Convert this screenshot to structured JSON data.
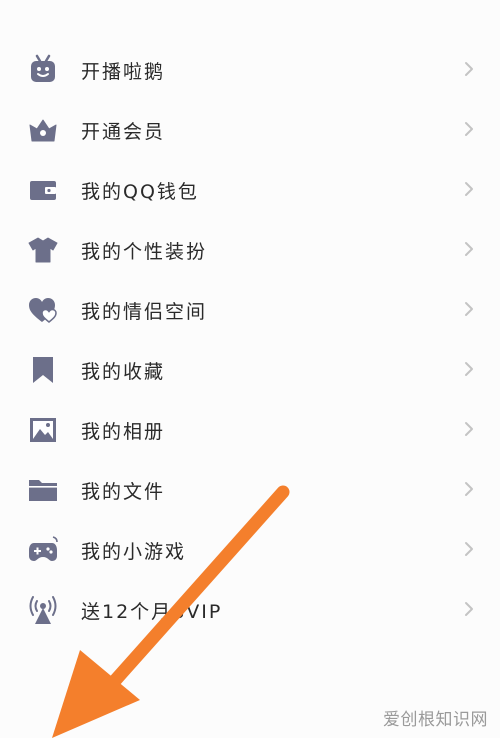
{
  "menu": {
    "items": [
      {
        "label": "开播啦鹅",
        "icon": "live-tv-icon"
      },
      {
        "label": "开通会员",
        "icon": "crown-icon"
      },
      {
        "label": "我的QQ钱包",
        "icon": "wallet-icon"
      },
      {
        "label": "我的个性装扮",
        "icon": "tshirt-icon"
      },
      {
        "label": "我的情侣空间",
        "icon": "couple-heart-icon"
      },
      {
        "label": "我的收藏",
        "icon": "bookmark-icon"
      },
      {
        "label": "我的相册",
        "icon": "photo-album-icon"
      },
      {
        "label": "我的文件",
        "icon": "folder-icon"
      },
      {
        "label": "我的小游戏",
        "icon": "gamepad-icon"
      },
      {
        "label": "送12个月SVIP",
        "icon": "broadcast-tower-icon"
      }
    ]
  },
  "watermark": "爱创根知识网",
  "colors": {
    "icon": "#6c6f8a",
    "text": "#2a2a2a",
    "chevron": "#c4c4c4",
    "arrow": "#f47f2c",
    "background": "#fcfcfc"
  }
}
